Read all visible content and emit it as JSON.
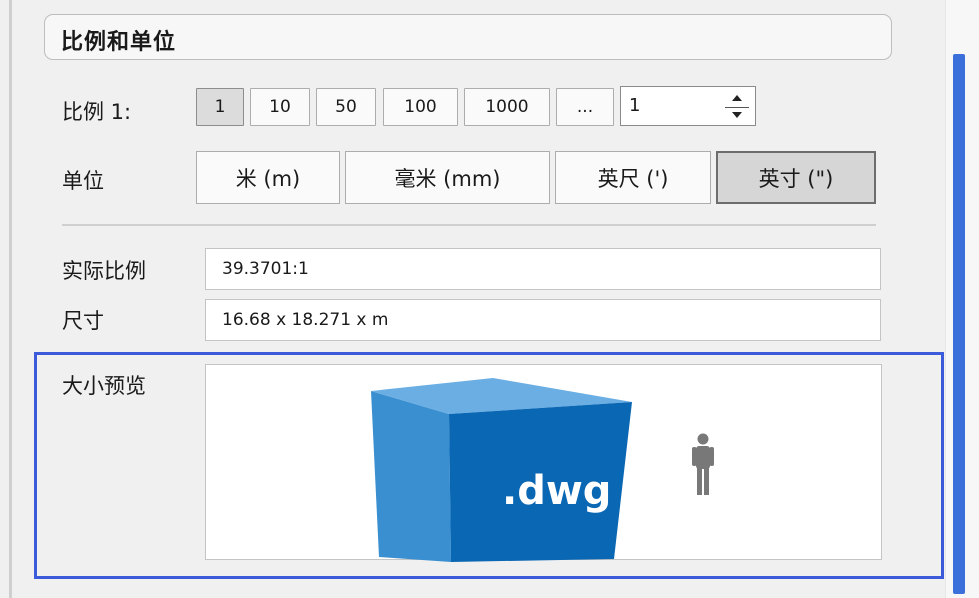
{
  "section": {
    "title": "比例和单位"
  },
  "scale": {
    "label": "比例 1:",
    "buttons": [
      "1",
      "10",
      "50",
      "100",
      "1000",
      "..."
    ],
    "selected_value": "1",
    "custom_value": "1"
  },
  "units": {
    "label": "单位",
    "buttons": [
      "米 (m)",
      "毫米 (mm)",
      "英尺 (')",
      "英寸 (\")"
    ],
    "selected": "英寸 (\")"
  },
  "actual_scale": {
    "label": "实际比例",
    "value": "39.3701:1"
  },
  "dimensions": {
    "label": "尺寸",
    "value": "16.68 x 18.271 x  m"
  },
  "preview": {
    "label": "大小预览",
    "cube_text": ".dwg",
    "icons": [
      "dwg-cube-icon",
      "person-icon"
    ]
  },
  "colors": {
    "accent_frame": "#3b5bdb",
    "cube_front": "#0a67b3",
    "cube_left": "#3a8fd0",
    "cube_top": "#6aaee3"
  }
}
